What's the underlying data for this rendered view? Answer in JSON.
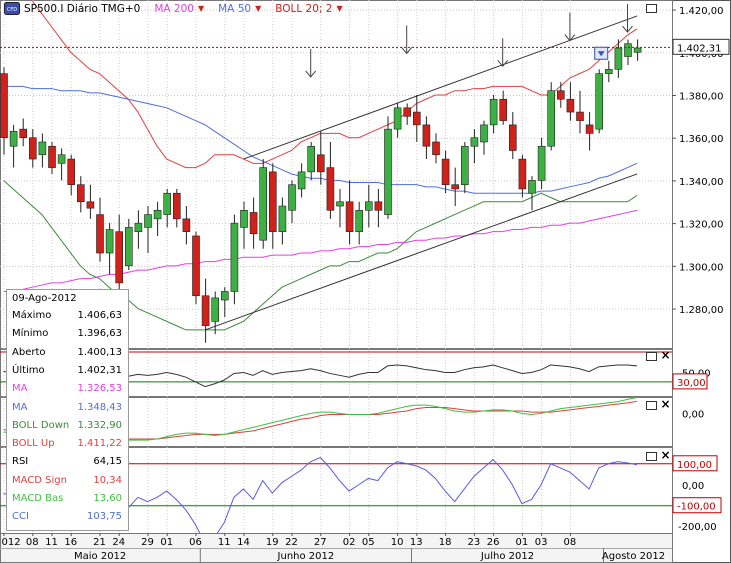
{
  "header": {
    "symbol": "SP500.I Diário TMG+0",
    "ma200": "MA 200",
    "ma50": "MA 50",
    "boll": "BOLL 20; 2"
  },
  "colors": {
    "up_candle": "#3cb043",
    "down_candle": "#d0211b",
    "ma200": "#e040e0",
    "ma50": "#4f6fd8",
    "boll_upper": "#e04040",
    "boll_lower": "#3c8a3c",
    "rsi_line": "#333333",
    "macd_signal": "#e04040",
    "macd_base": "#40c040",
    "cci_line": "#5a5ae0",
    "level_high": "#c00000",
    "level_low": "#008000",
    "price_line": "#c00000"
  },
  "price_axis": {
    "ticks": [
      "1.420,00",
      "1.400,00",
      "1.380,00",
      "1.360,00",
      "1.340,00",
      "1.320,00",
      "1.300,00",
      "1.280,00"
    ],
    "current": "1.402,31"
  },
  "rsi_axis": {
    "ticks": [
      "50,00"
    ],
    "level": "30,00"
  },
  "macd_axis": {
    "ticks": [
      "0,00"
    ]
  },
  "cci_axis": {
    "ticks": [
      "0,00",
      "-200,00"
    ],
    "level_high": "100,00",
    "level_low": "-100,00"
  },
  "date_axis": {
    "days": [
      "012",
      "08",
      "11",
      "16",
      "21",
      "24",
      "29",
      "01",
      "06",
      "11",
      "14",
      "19",
      "22",
      "27",
      "02",
      "05",
      "10",
      "13",
      "18",
      "23",
      "26",
      "01",
      "03",
      "08"
    ],
    "months": [
      "Maio 2012",
      "Junho 2012",
      "Julho 2012",
      "Agosto 2012"
    ]
  },
  "databox": {
    "date": "09-Ago-2012",
    "rows": [
      {
        "k": "Máximo",
        "v": "1.406,63",
        "color": "#000000"
      },
      {
        "k": "Mínimo",
        "v": "1.396,63",
        "color": "#000000"
      },
      {
        "k": "Aberto",
        "v": "1.400,13",
        "color": "#000000"
      },
      {
        "k": "Último",
        "v": "1.402,31",
        "color": "#000000"
      },
      {
        "k": "MA",
        "v": "1.326,53",
        "color": "#e040e0"
      },
      {
        "k": "MA",
        "v": "1.348,43",
        "color": "#4f6fd8"
      },
      {
        "k": "BOLL Down",
        "v": "1.332,90",
        "color": "#3c8a3c"
      },
      {
        "k": "BOLL Up",
        "v": "1.411,22",
        "color": "#e04040"
      },
      {
        "k": "RSI",
        "v": "64,15",
        "color": "#000000"
      },
      {
        "k": "MACD Sign",
        "v": "10,34",
        "color": "#e04040"
      },
      {
        "k": "MACD Bas",
        "v": "13,60",
        "color": "#40c040"
      },
      {
        "k": "CCI",
        "v": "103,75",
        "color": "#4f6fd8"
      }
    ]
  },
  "chart_data": {
    "type": "candlestick",
    "ylim": [
      1262,
      1424
    ],
    "candles": [
      [
        1390,
        1393,
        1352,
        1360
      ],
      [
        1356,
        1366,
        1346,
        1363
      ],
      [
        1364,
        1369,
        1356,
        1360
      ],
      [
        1360,
        1364,
        1346,
        1350
      ],
      [
        1352,
        1362,
        1346,
        1358
      ],
      [
        1356,
        1358,
        1343,
        1346
      ],
      [
        1348,
        1355,
        1340,
        1352
      ],
      [
        1350,
        1352,
        1333,
        1338
      ],
      [
        1338,
        1342,
        1325,
        1330
      ],
      [
        1330,
        1338,
        1322,
        1327
      ],
      [
        1324,
        1332,
        1302,
        1306
      ],
      [
        1306,
        1320,
        1296,
        1317
      ],
      [
        1316,
        1324,
        1288,
        1292
      ],
      [
        1300,
        1322,
        1298,
        1318
      ],
      [
        1316,
        1326,
        1308,
        1320
      ],
      [
        1318,
        1328,
        1306,
        1324
      ],
      [
        1322,
        1330,
        1314,
        1326
      ],
      [
        1324,
        1336,
        1318,
        1334
      ],
      [
        1334,
        1336,
        1318,
        1322
      ],
      [
        1322,
        1328,
        1310,
        1316
      ],
      [
        1314,
        1316,
        1282,
        1286
      ],
      [
        1286,
        1294,
        1264,
        1272
      ],
      [
        1274,
        1288,
        1268,
        1285
      ],
      [
        1284,
        1290,
        1276,
        1288
      ],
      [
        1288,
        1324,
        1282,
        1320
      ],
      [
        1318,
        1330,
        1308,
        1326
      ],
      [
        1325,
        1332,
        1308,
        1315
      ],
      [
        1312,
        1350,
        1308,
        1346
      ],
      [
        1344,
        1348,
        1308,
        1316
      ],
      [
        1316,
        1332,
        1310,
        1328
      ],
      [
        1326,
        1340,
        1320,
        1338
      ],
      [
        1336,
        1348,
        1332,
        1344
      ],
      [
        1344,
        1358,
        1340,
        1356
      ],
      [
        1352,
        1363,
        1338,
        1344
      ],
      [
        1346,
        1358,
        1322,
        1326
      ],
      [
        1328,
        1336,
        1318,
        1330
      ],
      [
        1330,
        1340,
        1310,
        1316
      ],
      [
        1316,
        1330,
        1310,
        1326
      ],
      [
        1326,
        1338,
        1318,
        1330
      ],
      [
        1330,
        1336,
        1318,
        1326
      ],
      [
        1324,
        1370,
        1322,
        1364
      ],
      [
        1364,
        1376,
        1360,
        1374
      ],
      [
        1374,
        1376,
        1366,
        1370
      ],
      [
        1372,
        1380,
        1358,
        1366
      ],
      [
        1366,
        1370,
        1350,
        1356
      ],
      [
        1358,
        1362,
        1348,
        1352
      ],
      [
        1350,
        1354,
        1334,
        1338
      ],
      [
        1338,
        1346,
        1328,
        1336
      ],
      [
        1338,
        1358,
        1334,
        1356
      ],
      [
        1356,
        1364,
        1348,
        1360
      ],
      [
        1358,
        1368,
        1352,
        1366
      ],
      [
        1366,
        1380,
        1362,
        1378
      ],
      [
        1378,
        1382,
        1366,
        1368
      ],
      [
        1366,
        1372,
        1350,
        1354
      ],
      [
        1350,
        1352,
        1332,
        1336
      ],
      [
        1334,
        1342,
        1326,
        1340
      ],
      [
        1340,
        1360,
        1336,
        1356
      ],
      [
        1356,
        1386,
        1354,
        1382
      ],
      [
        1382,
        1386,
        1374,
        1378
      ],
      [
        1378,
        1386,
        1368,
        1372
      ],
      [
        1372,
        1382,
        1362,
        1368
      ],
      [
        1366,
        1372,
        1354,
        1362
      ],
      [
        1364,
        1392,
        1362,
        1390
      ],
      [
        1390,
        1396,
        1386,
        1392
      ],
      [
        1392,
        1406,
        1388,
        1402
      ],
      [
        1398,
        1406,
        1394,
        1404
      ],
      [
        1400,
        1406,
        1396,
        1402
      ]
    ],
    "ma200": [
      1288,
      1288,
      1289,
      1290,
      1291,
      1292,
      1292,
      1293,
      1294,
      1294,
      1295,
      1296,
      1296,
      1297,
      1298,
      1298,
      1299,
      1300,
      1300,
      1301,
      1301,
      1302,
      1302,
      1303,
      1303,
      1304,
      1304,
      1304,
      1305,
      1305,
      1305,
      1306,
      1306,
      1307,
      1307,
      1308,
      1308,
      1309,
      1309,
      1310,
      1310,
      1311,
      1311,
      1312,
      1312,
      1313,
      1313,
      1314,
      1314,
      1315,
      1315,
      1316,
      1316,
      1317,
      1317,
      1318,
      1318,
      1319,
      1319,
      1320,
      1320,
      1321,
      1322,
      1323,
      1324,
      1325,
      1326
    ],
    "ma50": [
      1384,
      1384,
      1384,
      1383,
      1383,
      1383,
      1382,
      1382,
      1382,
      1381,
      1381,
      1380,
      1379,
      1378,
      1377,
      1376,
      1375,
      1374,
      1372,
      1370,
      1368,
      1366,
      1363,
      1360,
      1357,
      1354,
      1351,
      1349,
      1347,
      1345,
      1343,
      1342,
      1341,
      1341,
      1340,
      1340,
      1339,
      1339,
      1339,
      1339,
      1338,
      1338,
      1338,
      1338,
      1337,
      1337,
      1336,
      1335,
      1335,
      1334,
      1334,
      1334,
      1334,
      1334,
      1334,
      1334,
      1335,
      1335,
      1336,
      1337,
      1338,
      1339,
      1341,
      1342,
      1344,
      1346,
      1348
    ],
    "boll_upper": [
      1432,
      1430,
      1428,
      1424,
      1418,
      1412,
      1406,
      1400,
      1396,
      1392,
      1390,
      1386,
      1382,
      1378,
      1372,
      1364,
      1356,
      1350,
      1348,
      1346,
      1346,
      1348,
      1352,
      1352,
      1352,
      1350,
      1348,
      1348,
      1350,
      1352,
      1354,
      1358,
      1360,
      1362,
      1362,
      1362,
      1360,
      1360,
      1362,
      1364,
      1366,
      1368,
      1372,
      1376,
      1378,
      1380,
      1380,
      1382,
      1382,
      1383,
      1383,
      1384,
      1384,
      1384,
      1384,
      1382,
      1380,
      1380,
      1384,
      1388,
      1390,
      1392,
      1396,
      1400,
      1404,
      1408,
      1411
    ],
    "boll_lower": [
      1340,
      1336,
      1332,
      1328,
      1324,
      1318,
      1312,
      1306,
      1300,
      1296,
      1294,
      1290,
      1286,
      1284,
      1280,
      1278,
      1276,
      1274,
      1272,
      1270,
      1270,
      1270,
      1270,
      1270,
      1272,
      1274,
      1278,
      1282,
      1286,
      1290,
      1292,
      1294,
      1296,
      1298,
      1300,
      1300,
      1302,
      1302,
      1304,
      1306,
      1306,
      1308,
      1312,
      1316,
      1318,
      1320,
      1322,
      1324,
      1326,
      1328,
      1330,
      1330,
      1330,
      1330,
      1330,
      1332,
      1334,
      1332,
      1330,
      1330,
      1330,
      1330,
      1330,
      1330,
      1330,
      1330,
      1333
    ],
    "rsi": [
      52,
      50,
      46,
      40,
      44,
      38,
      42,
      44,
      36,
      40,
      34,
      42,
      36,
      42,
      46,
      44,
      46,
      50,
      46,
      40,
      30,
      20,
      26,
      34,
      48,
      50,
      44,
      54,
      46,
      50,
      52,
      54,
      58,
      54,
      48,
      44,
      40,
      46,
      50,
      50,
      64,
      66,
      64,
      60,
      56,
      54,
      50,
      50,
      56,
      60,
      62,
      66,
      60,
      54,
      48,
      50,
      56,
      66,
      64,
      62,
      58,
      52,
      62,
      64,
      66,
      66,
      64
    ],
    "macd_base": [
      -16,
      -17,
      -18,
      -20,
      -21,
      -22,
      -22,
      -22,
      -22,
      -22,
      -22,
      -22,
      -23,
      -23,
      -23,
      -23,
      -22,
      -20,
      -18,
      -17,
      -17,
      -18,
      -19,
      -18,
      -16,
      -14,
      -12,
      -10,
      -8,
      -6,
      -4,
      -2,
      0,
      1,
      1,
      0,
      -1,
      -1,
      -1,
      0,
      2,
      4,
      6,
      7,
      7,
      6,
      4,
      2,
      1,
      1,
      2,
      3,
      3,
      2,
      0,
      -1,
      0,
      2,
      4,
      5,
      6,
      7,
      8,
      9,
      10,
      12,
      13.6
    ],
    "macd_signal": [
      -14,
      -15,
      -16,
      -17,
      -18,
      -19,
      -20,
      -20,
      -21,
      -21,
      -21,
      -21,
      -22,
      -22,
      -22,
      -22,
      -22,
      -21,
      -20,
      -19,
      -18,
      -18,
      -18,
      -18,
      -17,
      -16,
      -15,
      -13,
      -11,
      -9,
      -7,
      -5,
      -4,
      -2,
      -1,
      -1,
      -1,
      -1,
      -1,
      -1,
      0,
      1,
      2,
      4,
      5,
      5,
      5,
      4,
      3,
      2,
      2,
      2,
      2,
      2,
      2,
      1,
      1,
      1,
      2,
      3,
      4,
      5,
      6,
      7,
      8,
      9,
      10.3
    ],
    "cci": [
      -40,
      -60,
      -90,
      -130,
      -110,
      -160,
      -120,
      -110,
      -170,
      -130,
      -180,
      -120,
      -170,
      -110,
      -60,
      -80,
      -60,
      -30,
      -70,
      -120,
      -190,
      -280,
      -250,
      -180,
      -60,
      -20,
      -70,
      20,
      -40,
      10,
      40,
      70,
      110,
      130,
      80,
      20,
      -30,
      0,
      30,
      20,
      80,
      110,
      100,
      90,
      70,
      30,
      -30,
      -80,
      -20,
      40,
      80,
      120,
      70,
      0,
      -90,
      -70,
      0,
      100,
      80,
      60,
      20,
      -20,
      80,
      100,
      110,
      104,
      95
    ],
    "cci_ylim": [
      -230,
      180
    ]
  }
}
